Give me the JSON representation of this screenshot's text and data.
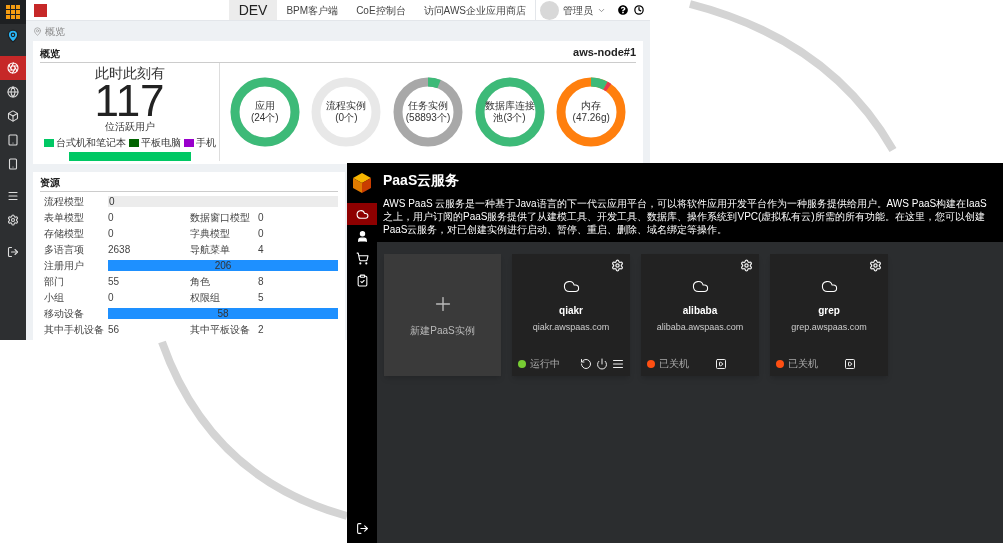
{
  "back_window": {
    "sidebar": {
      "items": [
        {
          "kind": "apps",
          "selected": false
        },
        {
          "kind": "location",
          "selected": false
        },
        {
          "kind": "dashboard",
          "selected": true
        },
        {
          "kind": "globe",
          "selected": false
        },
        {
          "kind": "cube",
          "selected": false
        },
        {
          "kind": "tablet",
          "selected": false
        },
        {
          "kind": "phone",
          "selected": false
        },
        {
          "kind": "menu",
          "selected": false
        },
        {
          "kind": "settings",
          "selected": false
        },
        {
          "kind": "exit",
          "selected": false
        }
      ]
    },
    "top_bar": {
      "tabs": [
        {
          "label": "DEV",
          "selected": true
        }
      ],
      "links": [
        "BPM客户端",
        "CoE控制台",
        "访问AWS企业应用商店"
      ],
      "user": "管理员"
    },
    "breadcrumb": "概览",
    "overview": {
      "title": "概览",
      "node": "aws-node#1",
      "headline": "此时此刻有",
      "active_users": "117",
      "active_users_label": "位活跃用户",
      "devices": [
        {
          "label": "台式机和笔记本",
          "color": "#00c864"
        },
        {
          "label": "平板电脑",
          "color": "#006400"
        },
        {
          "label": "手机",
          "color": "#9900cc"
        }
      ],
      "device_bar": {
        "level": 1
      },
      "gauges": [
        {
          "kind": "plain",
          "label": "应用",
          "value": "(24个)",
          "level": 1,
          "color": "#e8e8e8"
        },
        {
          "kind": "plain",
          "label": "流程实例",
          "value": "(0个)",
          "level": 0,
          "color": "#e8e8e8"
        },
        {
          "kind": "plain",
          "label": "任务实例",
          "value": "(58893个)",
          "level": 0.06,
          "color": "#a8a8a8"
        },
        {
          "kind": "plain",
          "label": "数据库连接",
          "value": "池(3个)",
          "level": 1,
          "color": "#e8e8e8"
        },
        {
          "kind": "memory",
          "label": "内存",
          "value": "(47.26g)",
          "level": 0.08,
          "color": "#ff7f0e"
        }
      ]
    },
    "resources": {
      "title": "资源",
      "rows": [
        {
          "kind": "bar",
          "label": "流程模型",
          "value": "0",
          "level": 0
        },
        {
          "kind": "pair",
          "cells": [
            {
              "label": "表单模型",
              "value": "0"
            },
            {
              "label": "数据窗口模型",
              "value": "0"
            }
          ]
        },
        {
          "kind": "pair",
          "cells": [
            {
              "label": "存储模型",
              "value": "0"
            },
            {
              "label": "字典模型",
              "value": "0"
            }
          ]
        },
        {
          "kind": "pair",
          "cells": [
            {
              "label": "多语言项",
              "value": "2638"
            },
            {
              "label": "导航菜单",
              "value": "4"
            }
          ]
        },
        {
          "kind": "bar",
          "label": "注册用户",
          "value": "206",
          "level": 1
        },
        {
          "kind": "pair",
          "cells": [
            {
              "label": "部门",
              "value": "55"
            },
            {
              "label": "角色",
              "value": "8"
            }
          ]
        },
        {
          "kind": "pair",
          "cells": [
            {
              "label": "小组",
              "value": "0"
            },
            {
              "label": "权限组",
              "value": "5"
            }
          ]
        },
        {
          "kind": "bar",
          "label": "移动设备",
          "value": "58",
          "level": 1
        },
        {
          "kind": "pair",
          "cells": [
            {
              "label": "其中手机设备",
              "value": "56"
            },
            {
              "label": "其中平板设备",
              "value": "2"
            }
          ]
        }
      ]
    }
  },
  "front_window": {
    "title": "PaaS云服务",
    "description": "AWS PaaS 云服务是一种基于Java语言的下一代云应用平台，可以将软件应用开发平台作为一种服务提供给用户。AWS PaaS构建在IaaS之上，用户订阅的PaaS服务提供了从建模工具、开发工具、数据库、操作系统到VPC(虚拟私有云)所需的所有功能。在这里，您可以创建PaaS云服务，对已创建实例进行启动、暂停、重启、删除、域名绑定等操作。",
    "sidebar": {
      "items": [
        {
          "kind": "cloud",
          "selected": true
        },
        {
          "kind": "user",
          "selected": false
        },
        {
          "kind": "cart",
          "selected": false
        },
        {
          "kind": "tasks",
          "selected": false
        }
      ]
    },
    "new_instance": "新建PaaS实例",
    "instances": [
      {
        "name": "qiakr",
        "domain": "qiakr.awspaas.com",
        "status": "运行中",
        "color": "#77cc33",
        "running": true
      },
      {
        "name": "alibaba",
        "domain": "alibaba.awspaas.com",
        "status": "已关机",
        "color": "#ff4f12",
        "running": false
      },
      {
        "name": "grep",
        "domain": "grep.awspaas.com",
        "status": "已关机",
        "color": "#ff4f12",
        "running": false
      }
    ]
  }
}
